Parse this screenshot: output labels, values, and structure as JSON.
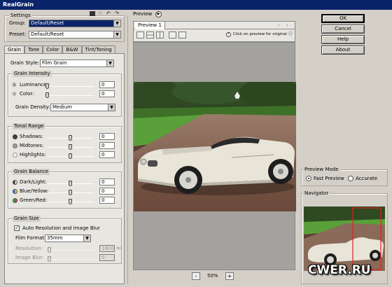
{
  "app_title": "RealGrain",
  "watermark": "CWER.RU",
  "settings": {
    "legend": "Settings",
    "group_label": "Group:",
    "group_value": "Default/Reset",
    "preset_label": "Preset:",
    "preset_value": "Default/Reset"
  },
  "tabs": [
    "Grain",
    "Tone",
    "Color",
    "B&W",
    "Tint/Toning"
  ],
  "grain_style": {
    "label": "Grain Style:",
    "value": "Film Grain"
  },
  "grain_intensity": {
    "legend": "Grain Intensity",
    "rows": [
      {
        "label": "Luminance:",
        "value": "0",
        "level": 0.0
      },
      {
        "label": "Color:",
        "value": "0",
        "level": 0.0
      }
    ],
    "density_label": "Grain Density:",
    "density_value": "Medium"
  },
  "tonal_range": {
    "legend": "Tonal Range",
    "rows": [
      {
        "label": "Shadows:",
        "value": "0",
        "level": 0.5,
        "dot": "#404040"
      },
      {
        "label": "Midtones:",
        "value": "0",
        "level": 0.5,
        "dot": "#9a9a9a"
      },
      {
        "label": "Highlights:",
        "value": "0",
        "level": 0.5,
        "dot": "#f0f0f0"
      }
    ]
  },
  "grain_balance": {
    "legend": "Grain Balance",
    "rows": [
      {
        "label": "Dark/Light:",
        "value": "0",
        "level": 0.5
      },
      {
        "label": "Blue/Yellow:",
        "value": "0",
        "level": 0.5
      },
      {
        "label": "Green/Red:",
        "value": "0",
        "level": 0.5
      }
    ]
  },
  "grain_size": {
    "legend": "Grain Size",
    "auto_label": "Auto Resolution and Image Blur",
    "auto_checked": true,
    "film_format_label": "Film Format:",
    "film_format_value": "35mm",
    "resolution_label": "Resolution:",
    "resolution_value": "1800",
    "resolution_unit": "dpi",
    "blur_label": "Image Blur:",
    "blur_value": "0"
  },
  "preview": {
    "legend": "Preview",
    "tab_label": "Preview 1",
    "hint": "Click on preview for original",
    "zoom": "50%",
    "zoom_minus": "-",
    "zoom_plus": "+"
  },
  "buttons": {
    "ok": "OK",
    "cancel": "Cancel",
    "help": "Help",
    "about": "About"
  },
  "preview_mode": {
    "legend": "Preview Mode",
    "fast_label": "Fast Preview",
    "accurate_label": "Accurate",
    "selected": "fast"
  },
  "navigator": {
    "legend": "Navigator"
  },
  "colors": {
    "titlebar": "#0a246a",
    "dialog_bg": "#d4d0c8",
    "nav_frame": "#e02020"
  }
}
